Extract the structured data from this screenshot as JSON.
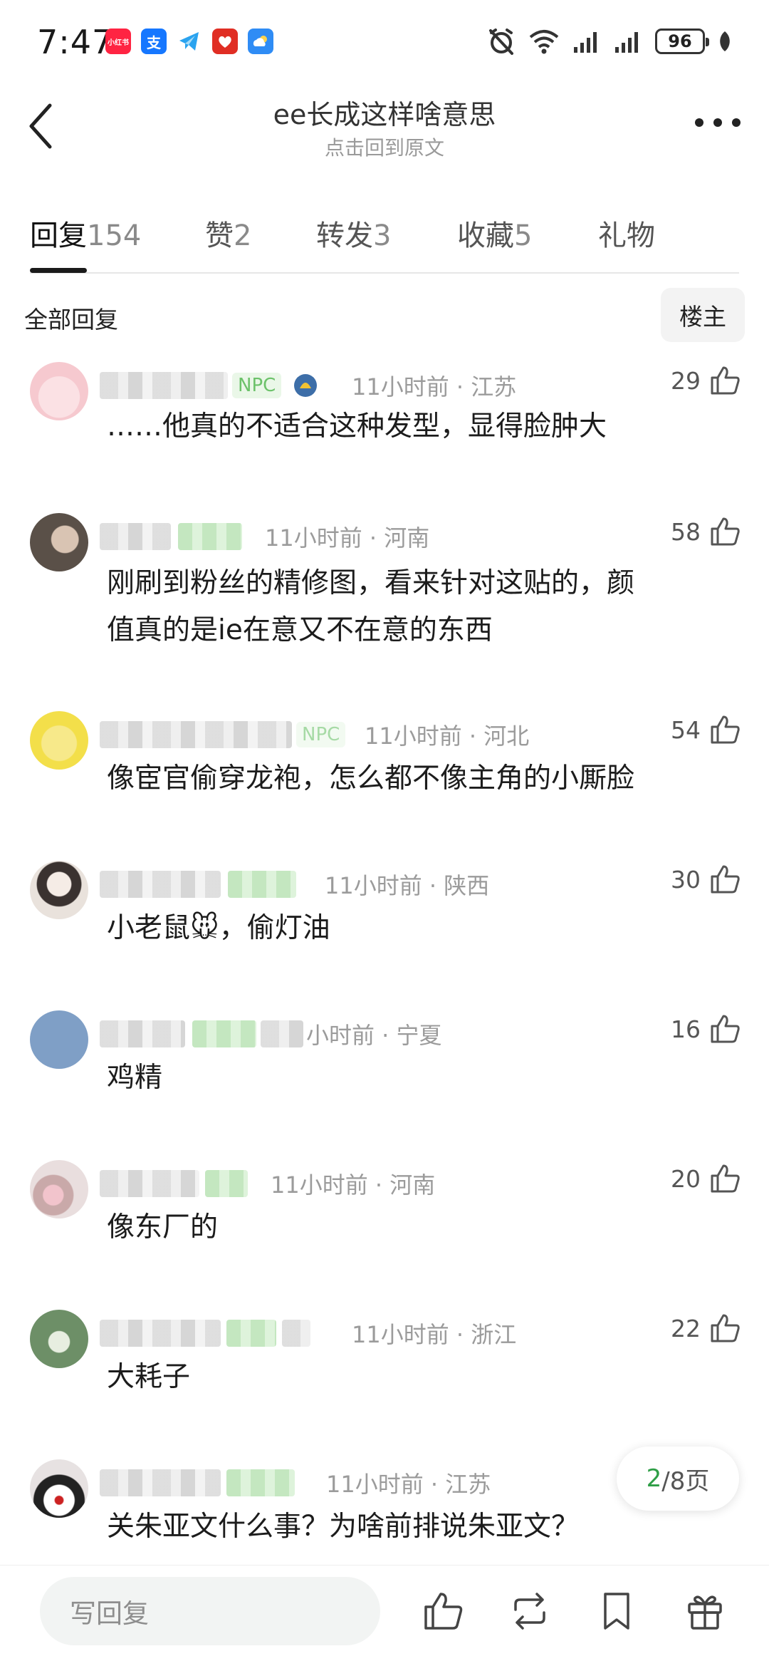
{
  "status_bar": {
    "time": "7:47",
    "battery": "96",
    "app_icons": [
      {
        "name": "xiaohongshu-app-icon",
        "label": "小红书",
        "color": "#ff2442"
      },
      {
        "name": "alipay-app-icon",
        "label": "支",
        "color": "#1677ff"
      },
      {
        "name": "telegram-app-icon",
        "label": "",
        "color": "#2aa3ef"
      },
      {
        "name": "pinduoduo-app-icon",
        "label": "",
        "color": "#e02e24"
      },
      {
        "name": "weather-app-icon",
        "label": "",
        "color": "#2f8cf5"
      }
    ]
  },
  "nav": {
    "title": "ee长成这样啥意思",
    "subtitle": "点击回到原文"
  },
  "tabs": [
    {
      "label": "回复",
      "count": "154",
      "active": true
    },
    {
      "label": "赞",
      "count": "2",
      "active": false
    },
    {
      "label": "转发",
      "count": "3",
      "active": false
    },
    {
      "label": "收藏",
      "count": "5",
      "active": false
    },
    {
      "label": "礼物",
      "count": "",
      "active": false
    }
  ],
  "filter": {
    "label": "全部回复",
    "owner_button": "楼主"
  },
  "comments": [
    {
      "badge": "NPC",
      "time_loc": "11小时前 · 江苏",
      "likes": "29",
      "text_lines": [
        "……他真的不适合这种发型，显得脸肿大"
      ],
      "avatar_color": "#f6c9cf"
    },
    {
      "badge": "",
      "time_loc": "11小时前 · 河南",
      "likes": "58",
      "text_lines": [
        "刚刷到粉丝的精修图，看来针对这贴的，颜",
        "值真的是ie在意又不在意的东西"
      ],
      "avatar_color": "#8a8178"
    },
    {
      "badge": "NPC",
      "time_loc": "11小时前 · 河北",
      "likes": "54",
      "text_lines": [
        "像宦官偷穿龙袍，怎么都不像主角的小厮脸"
      ],
      "avatar_color": "#f3df4a"
    },
    {
      "badge": "",
      "time_loc": "11小时前 · 陕西",
      "likes": "30",
      "text_lines": [
        "小老鼠🐭，偷灯油"
      ],
      "avatar_color": "#e9e2dc"
    },
    {
      "badge": "",
      "time_loc": "小时前 · 宁夏",
      "likes": "16",
      "text_lines": [
        "鸡精"
      ],
      "avatar_color": "#7f9fc6"
    },
    {
      "badge": "",
      "time_loc": "11小时前 · 河南",
      "likes": "20",
      "text_lines": [
        "像东厂的"
      ],
      "avatar_color": "#c9a9a9"
    },
    {
      "badge": "",
      "time_loc": "11小时前 · 浙江",
      "likes": "22",
      "text_lines": [
        "大耗子"
      ],
      "avatar_color": "#6d8f67"
    },
    {
      "badge": "",
      "time_loc": "11小时前 · 江苏",
      "likes": "",
      "text_lines": [
        "关朱亚文什么事？为啥前排说朱亚文？"
      ],
      "avatar_color": "#e7e2e2"
    }
  ],
  "page_indicator": {
    "current": "2",
    "rest": "/8页"
  },
  "bottom_bar": {
    "reply_placeholder": "写回复"
  }
}
